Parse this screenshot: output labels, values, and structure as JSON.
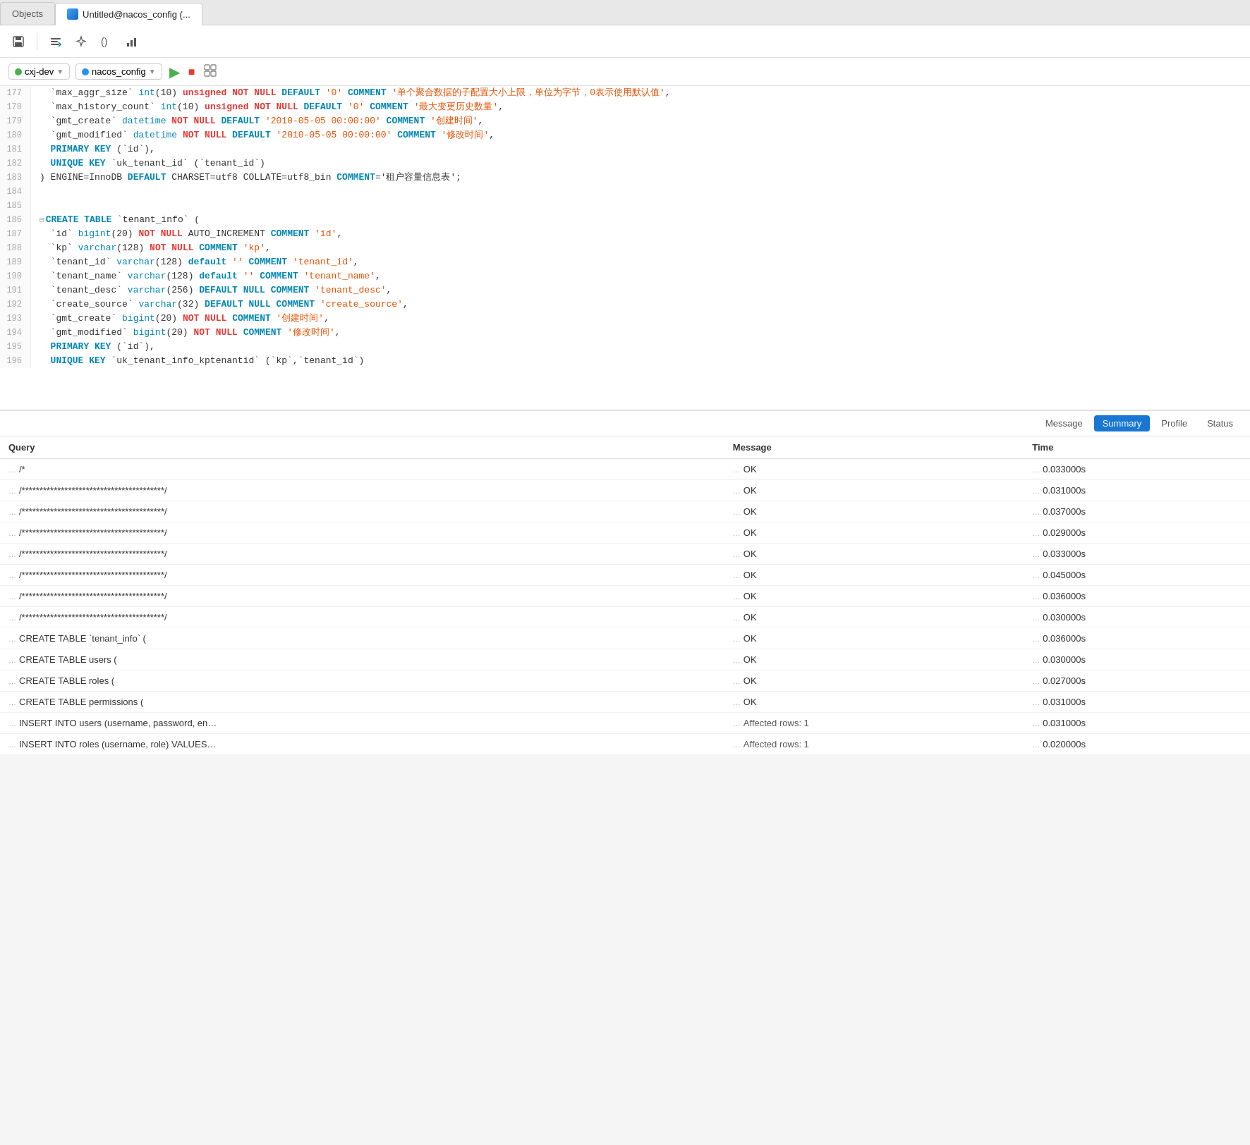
{
  "tabs": [
    {
      "id": "objects",
      "label": "Objects",
      "active": false,
      "hasIcon": false
    },
    {
      "id": "editor",
      "label": "Untitled@nacos_config (...",
      "active": true,
      "hasIcon": true
    }
  ],
  "toolbar": {
    "save_label": "💾",
    "format_label": "⌘",
    "magic_label": "✨",
    "paren_label": "()",
    "chart_label": "📊"
  },
  "connection": {
    "db1_label": "cxj-dev",
    "db2_label": "nacos_config",
    "run_label": "▶",
    "stop_label": "■",
    "explain_label": "⊞"
  },
  "editor": {
    "lines": [
      {
        "num": 177,
        "content": "  `max_aggr_size` int(10) unsigned NOT NULL DEFAULT '0' COMMENT '单个聚合数据的子配置大小上限，单位为字节，0表示使用默认值',"
      },
      {
        "num": 178,
        "content": "  `max_history_count` int(10) unsigned NOT NULL DEFAULT '0' COMMENT '最大变更历史数量',"
      },
      {
        "num": 179,
        "content": "  `gmt_create` datetime NOT NULL DEFAULT '2010-05-05 00:00:00' COMMENT '创建时间',"
      },
      {
        "num": 180,
        "content": "  `gmt_modified` datetime NOT NULL DEFAULT '2010-05-05 00:00:00' COMMENT '修改时间',"
      },
      {
        "num": 181,
        "content": "  PRIMARY KEY (`id`),"
      },
      {
        "num": 182,
        "content": "  UNIQUE KEY `uk_tenant_id` (`tenant_id`)"
      },
      {
        "num": 183,
        "content": ") ENGINE=InnoDB DEFAULT CHARSET=utf8 COLLATE=utf8_bin COMMENT='租户容量信息表';"
      },
      {
        "num": 184,
        "content": ""
      },
      {
        "num": 185,
        "content": ""
      },
      {
        "num": 186,
        "content": "CREATE TABLE `tenant_info` (",
        "collapse": true
      },
      {
        "num": 187,
        "content": "  `id` bigint(20) NOT NULL AUTO_INCREMENT COMMENT 'id',"
      },
      {
        "num": 188,
        "content": "  `kp` varchar(128) NOT NULL COMMENT 'kp',"
      },
      {
        "num": 189,
        "content": "  `tenant_id` varchar(128) default '' COMMENT 'tenant_id',"
      },
      {
        "num": 190,
        "content": "  `tenant_name` varchar(128) default '' COMMENT 'tenant_name',"
      },
      {
        "num": 191,
        "content": "  `tenant_desc` varchar(256) DEFAULT NULL COMMENT 'tenant_desc',"
      },
      {
        "num": 192,
        "content": "  `create_source` varchar(32) DEFAULT NULL COMMENT 'create_source',"
      },
      {
        "num": 193,
        "content": "  `gmt_create` bigint(20) NOT NULL COMMENT '创建时间',"
      },
      {
        "num": 194,
        "content": "  `gmt_modified` bigint(20) NOT NULL COMMENT '修改时间',"
      },
      {
        "num": 195,
        "content": "  PRIMARY KEY (`id`),"
      },
      {
        "num": 196,
        "content": "  UNIQUE KEY `uk_tenant_info_kptenantid` (`kp`,`tenant_id`)"
      }
    ]
  },
  "results": {
    "tabs": [
      {
        "id": "message",
        "label": "Message",
        "active": false
      },
      {
        "id": "summary",
        "label": "Summary",
        "active": true
      },
      {
        "id": "profile",
        "label": "Profile",
        "active": false
      },
      {
        "id": "status",
        "label": "Status",
        "active": false
      }
    ],
    "columns": [
      "Query",
      "Message",
      "Time"
    ],
    "rows": [
      {
        "query": "/*",
        "message": "OK",
        "time": "0.033000s"
      },
      {
        "query": "/****************************************/",
        "message": "OK",
        "time": "0.031000s"
      },
      {
        "query": "/****************************************/",
        "message": "OK",
        "time": "0.037000s"
      },
      {
        "query": "/****************************************/",
        "message": "OK",
        "time": "0.029000s"
      },
      {
        "query": "/****************************************/",
        "message": "OK",
        "time": "0.033000s"
      },
      {
        "query": "/****************************************/",
        "message": "OK",
        "time": "0.045000s"
      },
      {
        "query": "/****************************************/",
        "message": "OK",
        "time": "0.036000s"
      },
      {
        "query": "/****************************************/",
        "message": "OK",
        "time": "0.030000s"
      },
      {
        "query": "CREATE TABLE `tenant_info` (",
        "message": "OK",
        "time": "0.036000s"
      },
      {
        "query": "CREATE TABLE users (",
        "message": "OK",
        "time": "0.030000s"
      },
      {
        "query": "CREATE TABLE roles (",
        "message": "OK",
        "time": "0.027000s"
      },
      {
        "query": "CREATE TABLE permissions (",
        "message": "OK",
        "time": "0.031000s"
      },
      {
        "query": "INSERT INTO users (username, password, en…",
        "message": "Affected rows: 1",
        "time": "0.031000s"
      },
      {
        "query": "INSERT INTO roles (username, role) VALUES…",
        "message": "Affected rows: 1",
        "time": "0.020000s"
      }
    ]
  }
}
